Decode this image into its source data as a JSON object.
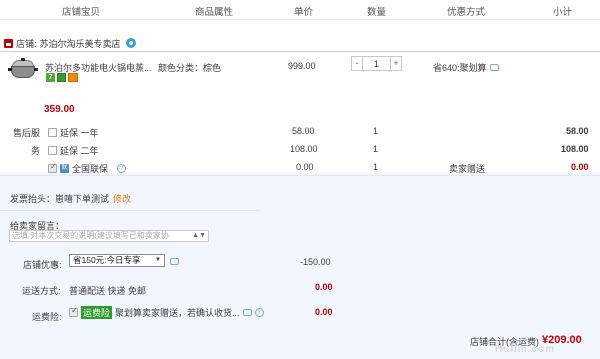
{
  "header": {
    "col_shop": "店铺宝贝",
    "col_attr": "商品属性",
    "col_price": "单价",
    "col_qty": "数量",
    "col_promo": "优惠方式",
    "col_subtotal": "小计"
  },
  "shop": {
    "label": "店铺:",
    "name": "苏泊尔淘乐美专卖店"
  },
  "item": {
    "title": "苏泊尔多功能电火锅电蒸...",
    "sku": "颜色分类：棕色",
    "price": "999.00",
    "qty": "1",
    "qty_minus": "-",
    "qty_plus": "+",
    "promo": "省640:聚划算",
    "subtotal": "359.00",
    "badge_7": "7"
  },
  "services": {
    "label_line1": "售后服",
    "label_line2": "务",
    "rows": [
      {
        "name": "延保 一年",
        "price": "58.00",
        "qty": "1",
        "total": "58.00"
      },
      {
        "name": "延保 二年",
        "price": "108.00",
        "qty": "1",
        "total": "108.00"
      },
      {
        "name": "全国联保",
        "price": "0.00",
        "qty": "1",
        "note": "卖家赠送",
        "total": "0.00"
      }
    ]
  },
  "invoice": {
    "label": "发票抬头：",
    "value": "崽嘻下单测试",
    "edit": "修改"
  },
  "message": {
    "label": "给卖家留言：",
    "placeholder": "选填:对本次交易的说明(建议填写已和卖家协"
  },
  "discount": {
    "label": "店铺优惠:",
    "selected": "省150元:今日专享",
    "value": "-150.00"
  },
  "shipping": {
    "label": "运送方式:",
    "value": "普通配送 快递 免邮",
    "price": "0.00"
  },
  "insurance": {
    "label": "运费险:",
    "highlight": "运费险",
    "text": "聚划算卖家赠送，若确认收货...",
    "price": "0.00"
  },
  "footer": {
    "label": "店铺合计(含运费)",
    "total": "¥209.00"
  },
  "watermark": "Hulim.com",
  "colors": {
    "accent_red": "#c40000",
    "box_bg": "#f2f7ff",
    "box_border": "#b2d1ff",
    "link_orange": "#e07a00"
  }
}
